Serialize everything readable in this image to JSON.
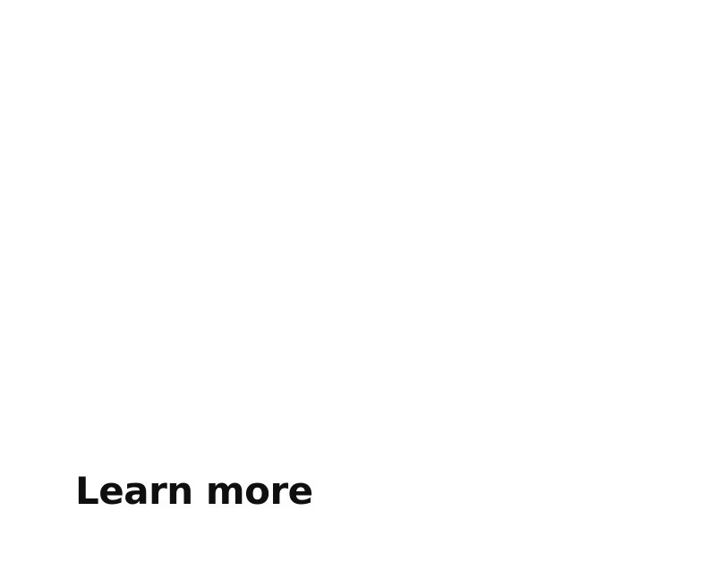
{
  "main": {
    "heading_link": "Learn more"
  }
}
